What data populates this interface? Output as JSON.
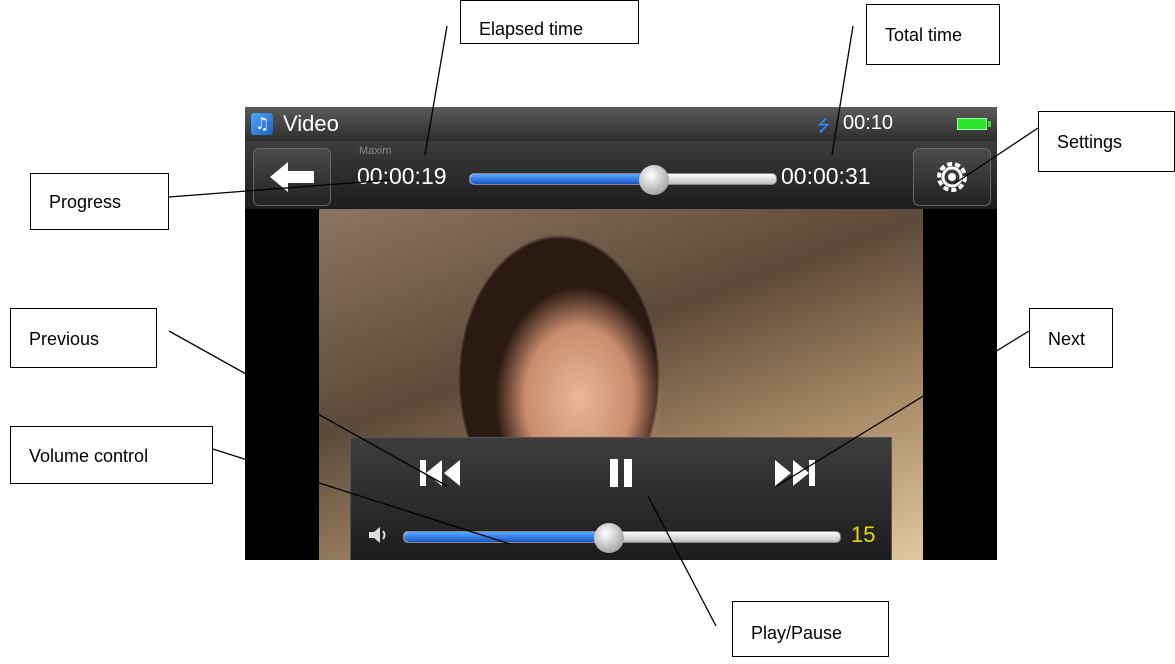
{
  "status_bar": {
    "app_title": "Video",
    "clock": "00:10",
    "usb_icon": "usb-icon",
    "battery_icon": "battery-icon",
    "app_icon": "video-app-icon"
  },
  "player": {
    "track_name": "Maxim",
    "elapsed": "00:00:19",
    "total": "00:00:31",
    "progress_fraction": 0.6,
    "volume_fraction": 0.47,
    "volume_value": "15",
    "back_icon": "back-arrow-icon",
    "settings_icon": "gear-icon",
    "previous_icon": "skip-previous-icon",
    "pause_icon": "pause-icon",
    "next_icon": "skip-next-icon",
    "volume_icon": "speaker-icon"
  },
  "callouts": {
    "elapsed_time": "Elapsed time",
    "total_time": "Total time",
    "settings": "Settings",
    "progress": "Progress",
    "previous": "Previous",
    "next": "Next",
    "volume_control": "Volume control",
    "play_pause": "Play/Pause"
  },
  "colors": {
    "accent_blue": "#2a7de1",
    "volume_text": "#e6d800",
    "battery": "#2ee62e"
  }
}
